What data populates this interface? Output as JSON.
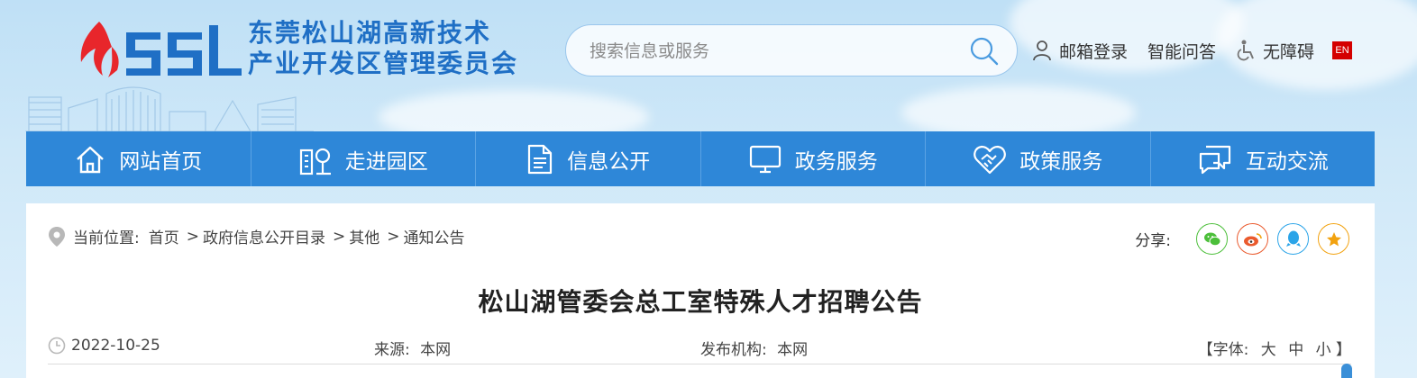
{
  "header": {
    "site_name_line1": "东莞松山湖高新技术",
    "site_name_line2": "产业开发区管理委员会",
    "logo_icon": "ssl-logo-icon"
  },
  "search": {
    "placeholder": "搜索信息或服务",
    "icon": "search-icon"
  },
  "toplinks": {
    "mail": "邮箱登录",
    "qa": "智能问答",
    "accessible": "无障碍",
    "en": "EN"
  },
  "nav": [
    {
      "label": "网站首页",
      "icon": "home-icon"
    },
    {
      "label": "走进园区",
      "icon": "park-icon"
    },
    {
      "label": "信息公开",
      "icon": "document-icon"
    },
    {
      "label": "政务服务",
      "icon": "monitor-icon"
    },
    {
      "label": "政策服务",
      "icon": "heart-handshake-icon"
    },
    {
      "label": "互动交流",
      "icon": "chat-icon"
    }
  ],
  "breadcrumb": {
    "prefix": "当前位置:",
    "items": [
      "首页",
      "政府信息公开目录",
      "其他",
      "通知公告"
    ],
    "separator": ">"
  },
  "share": {
    "label": "分享:",
    "items": [
      {
        "name": "wechat",
        "color": "#4cbf3a"
      },
      {
        "name": "weibo",
        "color": "#ea5a2d"
      },
      {
        "name": "qq",
        "color": "#2ba4e8"
      },
      {
        "name": "favorite",
        "color": "#f2a20f"
      }
    ]
  },
  "article": {
    "title": "松山湖管委会总工室特殊人才招聘公告",
    "date": "2022-10-25",
    "source_label": "来源:",
    "source": "本网",
    "org_label": "发布机构:",
    "org": "本网",
    "font_label": "【字体:",
    "font_large": "大",
    "font_medium": "中",
    "font_small": "小",
    "font_close": "】"
  },
  "colors": {
    "brand_blue": "#2e87d8",
    "title_blue": "#1f6fc5",
    "en_red": "#d40000"
  }
}
